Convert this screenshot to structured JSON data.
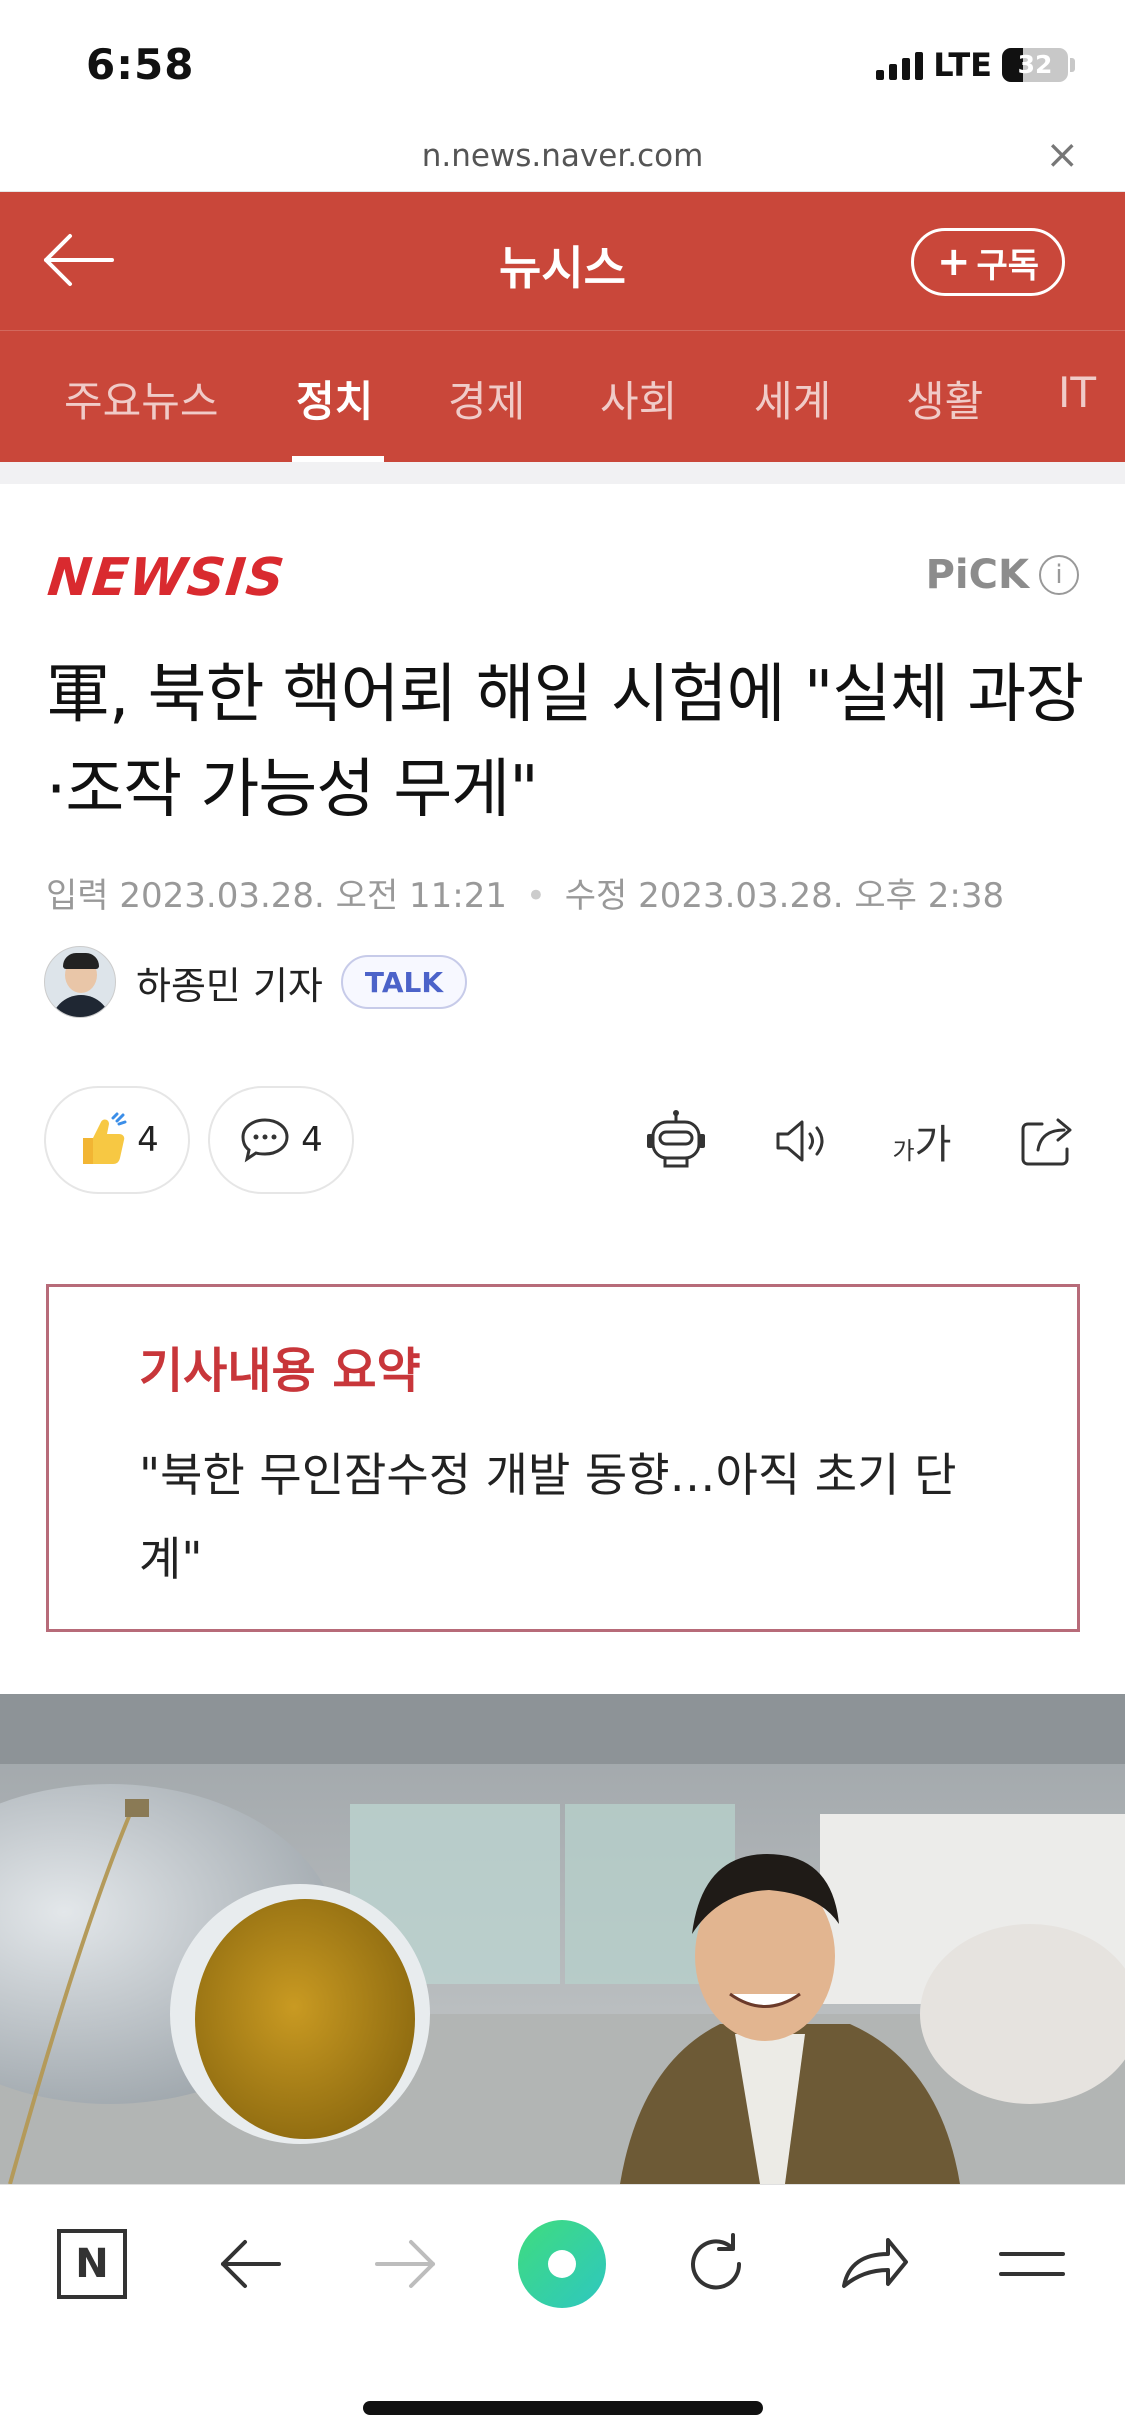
{
  "status_bar": {
    "time": "6:58",
    "network": "LTE",
    "battery": "32"
  },
  "browser": {
    "url": "n.news.naver.com",
    "close_icon": "close-icon"
  },
  "header": {
    "title": "뉴시스",
    "subscribe_label": "구독",
    "subscribe_plus": "+",
    "tabs": [
      {
        "label": "주요뉴스",
        "active": false
      },
      {
        "label": "정치",
        "active": true
      },
      {
        "label": "경제",
        "active": false
      },
      {
        "label": "사회",
        "active": false
      },
      {
        "label": "세계",
        "active": false
      },
      {
        "label": "생활",
        "active": false
      },
      {
        "label": "IT",
        "active": false
      }
    ],
    "accent_color": "#c9473a"
  },
  "article": {
    "press_logo": "NEWSIS",
    "pick_label": "PiCK",
    "pick_info": "i",
    "headline": "軍, 북한 핵어뢰 해일 시험에 \"실체 과장·조작 가능성 무게\"",
    "input_label": "입력",
    "input_date": "2023.03.28. 오전 11:21",
    "modified_label": "수정",
    "modified_date": "2023.03.28. 오후 2:38",
    "reporter": "하종민 기자",
    "talk_badge": "TALK",
    "likes": "4",
    "comments": "4",
    "font_size_label_small": "가",
    "font_size_label_large": "가"
  },
  "summary": {
    "title": "기사내용 요약",
    "text": "\"북한 무인잠수정 개발 동향…아직 초기 단계\""
  },
  "toolbar": {
    "naver_label": "N"
  }
}
